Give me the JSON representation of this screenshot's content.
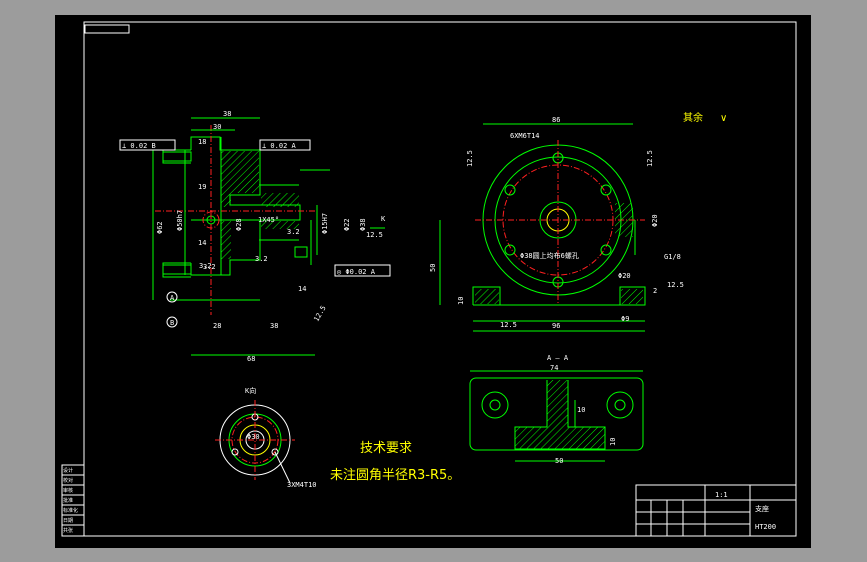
{
  "dims_front": {
    "d38": "38",
    "d30": "30",
    "d18": "18",
    "d19": "19",
    "d14a": "14",
    "d3_2a": "3.2",
    "d3_2b": "3.2",
    "phi62": "Φ62",
    "phi50": "Φ50h7",
    "phi28": "Φ28",
    "chamfer": "1X45°",
    "phi15": "Φ15H7",
    "phi22": "Φ22",
    "phi38": "Φ38",
    "d14b": "14",
    "d28": "28",
    "d38b": "38",
    "d68": "68",
    "d3_2c": "3.2",
    "d12_5a": "12.5",
    "d12_5b": "12.5",
    "d3_2d": "3.2"
  },
  "tol_front": {
    "perp1": "⊥ 0.02 B",
    "perp2": "⊥ 0.02 A",
    "conc": "◎ Φ0.02 A",
    "datum_a": "A",
    "datum_b": "B",
    "k_label": "K"
  },
  "dims_side": {
    "d86": "86",
    "holes": "6XM6T14",
    "d12_5a": "12.5",
    "d12_5b": "12.5",
    "phi20a": "Φ20",
    "thread": "G1/8",
    "phi20b": "Φ20",
    "d50": "50",
    "d10": "10",
    "d2": "2",
    "d12_5c": "12.5",
    "d12_5d": "12.5",
    "d96": "96",
    "phi9": "Φ9",
    "note": "Φ38圆上均布6螺孔"
  },
  "roughness": {
    "label": "其余",
    "value": "∨"
  },
  "section_aa": {
    "title": "A — A",
    "d74": "74",
    "d10a": "10",
    "d10b": "10",
    "d50": "50"
  },
  "view_k": {
    "title": "K向",
    "phi30": "Φ30",
    "holes": "3XM4T10"
  },
  "tech": {
    "title": "技术要求",
    "line1": "未注圆角半径R3-R5。"
  },
  "title_block": {
    "part_name": "支座",
    "material": "HT200",
    "scale": "1:1"
  },
  "side_table": [
    "设计",
    "校对",
    "审核",
    "批准",
    "标准化",
    "日期",
    "共张"
  ]
}
